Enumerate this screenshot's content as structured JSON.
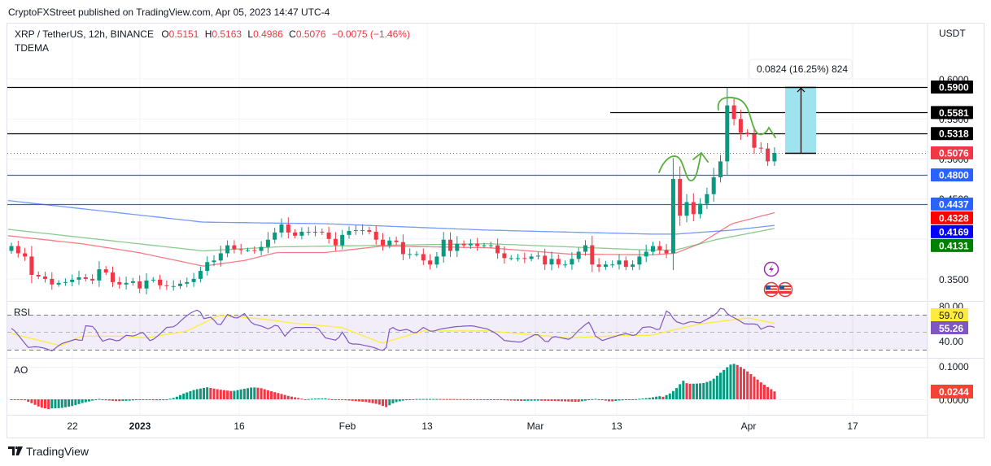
{
  "header": {
    "published": "CryptoFXStreet published on TradingView.com, Apr 05, 2023 14:47 UTC-4"
  },
  "legend": {
    "symbol": "XRP / TetherUS, 12h, BINANCE",
    "o_label": "O",
    "o": "0.5151",
    "h_label": "H",
    "h": "0.5163",
    "l_label": "L",
    "l": "0.4986",
    "c_label": "C",
    "c": "0.5076",
    "change": "−0.0075 (−1.46%)",
    "indicator": "TDEMA"
  },
  "price_axis": {
    "currency": "USDT",
    "ticks": [
      "0.6000",
      "0.5500",
      "0.5000",
      "0.4500",
      "0.3500"
    ]
  },
  "rsi_pane": {
    "title": "RSI",
    "ticks": [
      "80.00",
      "40.00"
    ],
    "ma_value": "59.70",
    "rsi_value": "55.26"
  },
  "ao_pane": {
    "title": "AO",
    "ticks": [
      "0.1000",
      "0.0000"
    ],
    "value": "0.0244"
  },
  "time_axis": {
    "ticks": [
      "22",
      "2023",
      "16",
      "Feb",
      "13",
      "Mar",
      "13",
      "Apr",
      "17"
    ]
  },
  "measure": {
    "label": "0.0824 (16.25%) 824"
  },
  "footer": {
    "brand": "TradingView"
  },
  "colors": {
    "up": "#089981",
    "down": "#f23645",
    "ema_fast": "#f23645",
    "ema_mid": "#4caf50",
    "ema_slow": "#2962ff",
    "rsi": "#7e57c2",
    "rsi_ma": "#ffeb3b",
    "measure_fill": "#9fe3ee",
    "annotation": "#5aae3c"
  },
  "chart_data": {
    "type": "candlestick",
    "title": "XRP / TetherUS, 12h, BINANCE",
    "ylabel": "USDT",
    "ylim": [
      0.33,
      0.61
    ],
    "grid": true,
    "x_unit": "days since 2022-12-13",
    "open_first": 0.385,
    "close": [
      0.391,
      0.382,
      0.378,
      0.355,
      0.353,
      0.35,
      0.343,
      0.345,
      0.346,
      0.349,
      0.352,
      0.35,
      0.348,
      0.362,
      0.358,
      0.346,
      0.343,
      0.345,
      0.347,
      0.338,
      0.348,
      0.349,
      0.342,
      0.341,
      0.341,
      0.344,
      0.346,
      0.35,
      0.36,
      0.371,
      0.373,
      0.382,
      0.392,
      0.387,
      0.386,
      0.386,
      0.385,
      0.39,
      0.399,
      0.408,
      0.418,
      0.408,
      0.404,
      0.409,
      0.409,
      0.409,
      0.408,
      0.4,
      0.392,
      0.405,
      0.41,
      0.411,
      0.411,
      0.409,
      0.399,
      0.392,
      0.398,
      0.396,
      0.381,
      0.381,
      0.381,
      0.373,
      0.368,
      0.378,
      0.399,
      0.385,
      0.394,
      0.392,
      0.394,
      0.391,
      0.392,
      0.392,
      0.382,
      0.376,
      0.376,
      0.376,
      0.375,
      0.378,
      0.379,
      0.368,
      0.375,
      0.368,
      0.368,
      0.375,
      0.384,
      0.392,
      0.368,
      0.365,
      0.368,
      0.368,
      0.373,
      0.365,
      0.368,
      0.378,
      0.384,
      0.391,
      0.386,
      0.382,
      0.475,
      0.429,
      0.446,
      0.431,
      0.444,
      0.456,
      0.477,
      0.497,
      0.567,
      0.55,
      0.533,
      0.531,
      0.514,
      0.513,
      0.497,
      0.5076
    ],
    "ema_lines": [
      {
        "name": "ema_fast",
        "last": "0.4328",
        "points": [
          [
            -0.5,
            0.404
          ],
          [
            10.4,
            0.394
          ],
          [
            18.8,
            0.383
          ],
          [
            28.4,
            0.366
          ],
          [
            34.5,
            0.373
          ],
          [
            39.3,
            0.383
          ],
          [
            46.5,
            0.383
          ],
          [
            54.9,
            0.391
          ],
          [
            70.6,
            0.389
          ],
          [
            82.7,
            0.381
          ],
          [
            94.7,
            0.38
          ],
          [
            98.3,
            0.382
          ],
          [
            101.9,
            0.394
          ],
          [
            106.7,
            0.419
          ],
          [
            113,
            0.4328
          ]
        ]
      },
      {
        "name": "ema_slow",
        "last": "0.4169",
        "points": [
          [
            -0.5,
            0.448
          ],
          [
            28.4,
            0.421
          ],
          [
            46.5,
            0.419
          ],
          [
            70.6,
            0.411
          ],
          [
            94.7,
            0.406
          ],
          [
            98.3,
            0.406
          ],
          [
            106.7,
            0.411
          ],
          [
            113,
            0.4169
          ]
        ]
      },
      {
        "name": "ema_mid",
        "last": "0.4131",
        "points": [
          [
            -0.5,
            0.412
          ],
          [
            28.4,
            0.385
          ],
          [
            39.3,
            0.39
          ],
          [
            54.9,
            0.392
          ],
          [
            70.6,
            0.394
          ],
          [
            94.7,
            0.386
          ],
          [
            98.3,
            0.386
          ],
          [
            104.3,
            0.399
          ],
          [
            113,
            0.4131
          ]
        ]
      }
    ],
    "price_levels": [
      {
        "value": 0.59,
        "label": "0.5900",
        "style": "black",
        "extent": "full"
      },
      {
        "value": 0.5581,
        "label": "0.5581",
        "style": "black",
        "extent": "short"
      },
      {
        "value": 0.5318,
        "label": "0.5318",
        "style": "black",
        "extent": "full"
      },
      {
        "value": 0.5076,
        "label": "0.5076",
        "style": "last-price",
        "extent": "full"
      },
      {
        "value": 0.48,
        "label": "0.4800",
        "style": "blue",
        "extent": "full"
      },
      {
        "value": 0.4437,
        "label": "0.4437",
        "style": "blue",
        "extent": "full"
      }
    ],
    "rsi": {
      "upper": 70,
      "middle": 50,
      "lower": 30,
      "points": [
        [
          0,
          54
        ],
        [
          0.5,
          51
        ],
        [
          2.5,
          32
        ],
        [
          3.7,
          33
        ],
        [
          5,
          31
        ],
        [
          6,
          28
        ],
        [
          7.3,
          36
        ],
        [
          8.5,
          39
        ],
        [
          9.8,
          42
        ],
        [
          10.4,
          37
        ],
        [
          11,
          57
        ],
        [
          12.2,
          56
        ],
        [
          13.4,
          39
        ],
        [
          14.6,
          42
        ],
        [
          15.8,
          39
        ],
        [
          17,
          46
        ],
        [
          18.2,
          45
        ],
        [
          19.4,
          50
        ],
        [
          20.6,
          39
        ],
        [
          21.8,
          46
        ],
        [
          23,
          55
        ],
        [
          24.2,
          56
        ],
        [
          25.4,
          65
        ],
        [
          26.6,
          72
        ],
        [
          27.8,
          76
        ],
        [
          28.4,
          65
        ],
        [
          29.6,
          67
        ],
        [
          30.8,
          56
        ],
        [
          32,
          70
        ],
        [
          33.3,
          65
        ],
        [
          34.5,
          71
        ],
        [
          35.7,
          59
        ],
        [
          36.9,
          57
        ],
        [
          38.1,
          53
        ],
        [
          39.3,
          59
        ],
        [
          40.5,
          45
        ],
        [
          41.7,
          55
        ],
        [
          42.9,
          55
        ],
        [
          44.1,
          55
        ],
        [
          45.3,
          55
        ],
        [
          46.5,
          43
        ],
        [
          48.3,
          40
        ],
        [
          48.9,
          51
        ],
        [
          50.1,
          36
        ],
        [
          51.3,
          36
        ],
        [
          52.5,
          34
        ],
        [
          53.7,
          32
        ],
        [
          54.9,
          28
        ],
        [
          55.5,
          32
        ],
        [
          56.1,
          57
        ],
        [
          57.3,
          51
        ],
        [
          58.6,
          53
        ],
        [
          59.8,
          48
        ],
        [
          61,
          55
        ],
        [
          62.2,
          50
        ],
        [
          63.4,
          53
        ],
        [
          65.8,
          56
        ],
        [
          68.2,
          57
        ],
        [
          70.6,
          53
        ],
        [
          71.8,
          48
        ],
        [
          73,
          40
        ],
        [
          75.4,
          38
        ],
        [
          77.8,
          48
        ],
        [
          79.3,
          37
        ],
        [
          80.2,
          45
        ],
        [
          82.7,
          41
        ],
        [
          83.9,
          51
        ],
        [
          85.1,
          59
        ],
        [
          85.7,
          62
        ],
        [
          86.3,
          46
        ],
        [
          87.5,
          40
        ],
        [
          88.7,
          43
        ],
        [
          89.9,
          46
        ],
        [
          91.1,
          48
        ],
        [
          92.3,
          45
        ],
        [
          93.5,
          55
        ],
        [
          94.7,
          56
        ],
        [
          95.9,
          51
        ],
        [
          97.1,
          76
        ],
        [
          98.3,
          62
        ],
        [
          99.5,
          59
        ],
        [
          100.7,
          62
        ],
        [
          101.9,
          60
        ],
        [
          103.1,
          65
        ],
        [
          104.3,
          70
        ],
        [
          105.2,
          79
        ],
        [
          106.1,
          70
        ],
        [
          107.3,
          65
        ],
        [
          108.6,
          59
        ],
        [
          110.4,
          59
        ],
        [
          111,
          53
        ],
        [
          112.2,
          57
        ],
        [
          113,
          55.26
        ]
      ],
      "ma_points": [
        [
          0,
          48
        ],
        [
          7.3,
          34
        ],
        [
          10.4,
          45
        ],
        [
          16.4,
          45
        ],
        [
          20,
          43
        ],
        [
          26,
          51
        ],
        [
          30.8,
          69
        ],
        [
          36.9,
          65
        ],
        [
          41.7,
          60
        ],
        [
          48.9,
          55
        ],
        [
          54.9,
          37
        ],
        [
          61,
          51
        ],
        [
          70.6,
          51
        ],
        [
          82.7,
          43
        ],
        [
          91.1,
          46
        ],
        [
          94.7,
          46
        ],
        [
          101.9,
          59
        ],
        [
          109.2,
          66
        ],
        [
          113,
          59.7
        ]
      ]
    },
    "ao": {
      "points": [
        [
          0,
          -0.002
        ],
        [
          2,
          -0.003
        ],
        [
          3,
          -0.012
        ],
        [
          4.3,
          -0.025
        ],
        [
          5.5,
          -0.03
        ],
        [
          6,
          -0.028
        ],
        [
          7.3,
          -0.027
        ],
        [
          9.2,
          -0.02
        ],
        [
          10.4,
          -0.012
        ],
        [
          12.2,
          -0.003
        ],
        [
          12.8,
          0.002
        ],
        [
          14,
          -0.003
        ],
        [
          15.8,
          -0.006
        ],
        [
          17.6,
          -0.004
        ],
        [
          19.4,
          -0.001
        ],
        [
          21.2,
          -0.003
        ],
        [
          22.4,
          -0.003
        ],
        [
          24.2,
          0.005
        ],
        [
          25.4,
          0.017
        ],
        [
          27.2,
          0.03
        ],
        [
          29,
          0.037
        ],
        [
          30.8,
          0.03
        ],
        [
          32.7,
          0.025
        ],
        [
          33.9,
          0.03
        ],
        [
          35.7,
          0.037
        ],
        [
          36.9,
          0.035
        ],
        [
          38.1,
          0.027
        ],
        [
          39.9,
          0.017
        ],
        [
          41.1,
          0.01
        ],
        [
          42.3,
          0.005
        ],
        [
          43.5,
          0
        ],
        [
          44.7,
          0.002
        ],
        [
          46.5,
          0.003
        ],
        [
          47.7,
          -0.001
        ],
        [
          48.9,
          -0.002
        ],
        [
          50.7,
          -0.005
        ],
        [
          52.5,
          -0.008
        ],
        [
          54.3,
          -0.015
        ],
        [
          55.5,
          -0.024
        ],
        [
          56.7,
          -0.01
        ],
        [
          58,
          -0.004
        ],
        [
          59.8,
          0.001
        ],
        [
          63.4,
          0.001
        ],
        [
          70.6,
          0
        ],
        [
          71.8,
          -0.002
        ],
        [
          75.4,
          -0.005
        ],
        [
          77.8,
          -0.004
        ],
        [
          80.2,
          -0.005
        ],
        [
          82.7,
          -0.007
        ],
        [
          83.9,
          -0.008
        ],
        [
          85.1,
          -0.004
        ],
        [
          86.3,
          0.002
        ],
        [
          87.5,
          -0.002
        ],
        [
          88.7,
          -0.007
        ],
        [
          89.9,
          -0.004
        ],
        [
          92.3,
          0
        ],
        [
          94.7,
          0.005
        ],
        [
          95.9,
          0.01
        ],
        [
          96.5,
          0.008
        ],
        [
          97.7,
          0.02
        ],
        [
          98.9,
          0.042
        ],
        [
          99.3,
          0.06
        ],
        [
          100.1,
          0.048
        ],
        [
          101.3,
          0.048
        ],
        [
          102.5,
          0.05
        ],
        [
          103.7,
          0.058
        ],
        [
          104.9,
          0.08
        ],
        [
          105.9,
          0.097
        ],
        [
          106.7,
          0.11
        ],
        [
          107.3,
          0.108
        ],
        [
          108.6,
          0.092
        ],
        [
          109.8,
          0.073
        ],
        [
          111,
          0.052
        ],
        [
          112.2,
          0.035
        ],
        [
          113,
          0.0244
        ]
      ]
    },
    "measure": {
      "from": 0.5076,
      "to": 0.59,
      "change": 0.0824,
      "percent": 16.25,
      "ticks": 824
    }
  }
}
